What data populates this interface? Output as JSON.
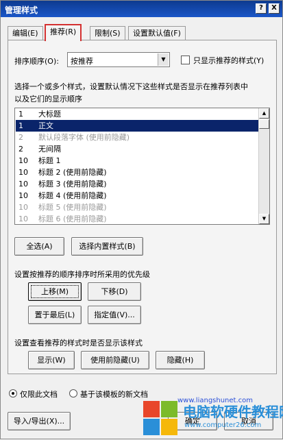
{
  "window": {
    "title": "管理样式",
    "help_label": "?",
    "close_label": "X"
  },
  "tabs": [
    {
      "label": "编辑(E)"
    },
    {
      "label": "推荐(R)"
    },
    {
      "label": "限制(S)"
    },
    {
      "label": "设置默认值(F)"
    }
  ],
  "sort": {
    "label": "排序顺序(O):",
    "value": "按推荐",
    "show_only_label": "只显示推荐的样式(Y)"
  },
  "instructions": {
    "line1": "选择一个或多个样式，设置默认情况下这些样式是否显示在推荐列表中",
    "line2": "以及它们的显示顺序"
  },
  "styles": [
    {
      "priority": "1",
      "name": "大标题"
    },
    {
      "priority": "1",
      "name": "正文"
    },
    {
      "priority": "2",
      "name": "默认段落字体  (使用前隐藏)"
    },
    {
      "priority": "2",
      "name": "无间隔"
    },
    {
      "priority": "10",
      "name": "标题 1"
    },
    {
      "priority": "10",
      "name": "标题 2  (使用前隐藏)"
    },
    {
      "priority": "10",
      "name": "标题 3  (使用前隐藏)"
    },
    {
      "priority": "10",
      "name": "标题 4  (使用前隐藏)"
    },
    {
      "priority": "10",
      "name": "标题 5  (使用前隐藏)"
    },
    {
      "priority": "10",
      "name": "标题 6  (使用前隐藏)"
    }
  ],
  "buttons": {
    "select_all": "全选(A)",
    "select_builtin": "选择内置样式(B)",
    "move_up": "上移(M)",
    "move_down": "下移(D)",
    "move_last": "置于最后(L)",
    "assign_value": "指定值(V)...",
    "show": "显示(W)",
    "hide_until_used": "使用前隐藏(U)",
    "hide": "隐藏(H)",
    "import_export": "导入/导出(X)...",
    "ok": "确定",
    "cancel": "取消"
  },
  "sections": {
    "priority_heading": "设置按推荐的顺序排序时所采用的优先级",
    "visibility_heading": "设置查看推荐的样式时是否显示该样式"
  },
  "scope": {
    "this_document": "仅限此文档",
    "new_documents": "基于该模板的新文档"
  },
  "watermark": {
    "brand": "电脑软硬件教程网",
    "url": "www.computer26.com",
    "url2": "www.liangshunet.com"
  }
}
